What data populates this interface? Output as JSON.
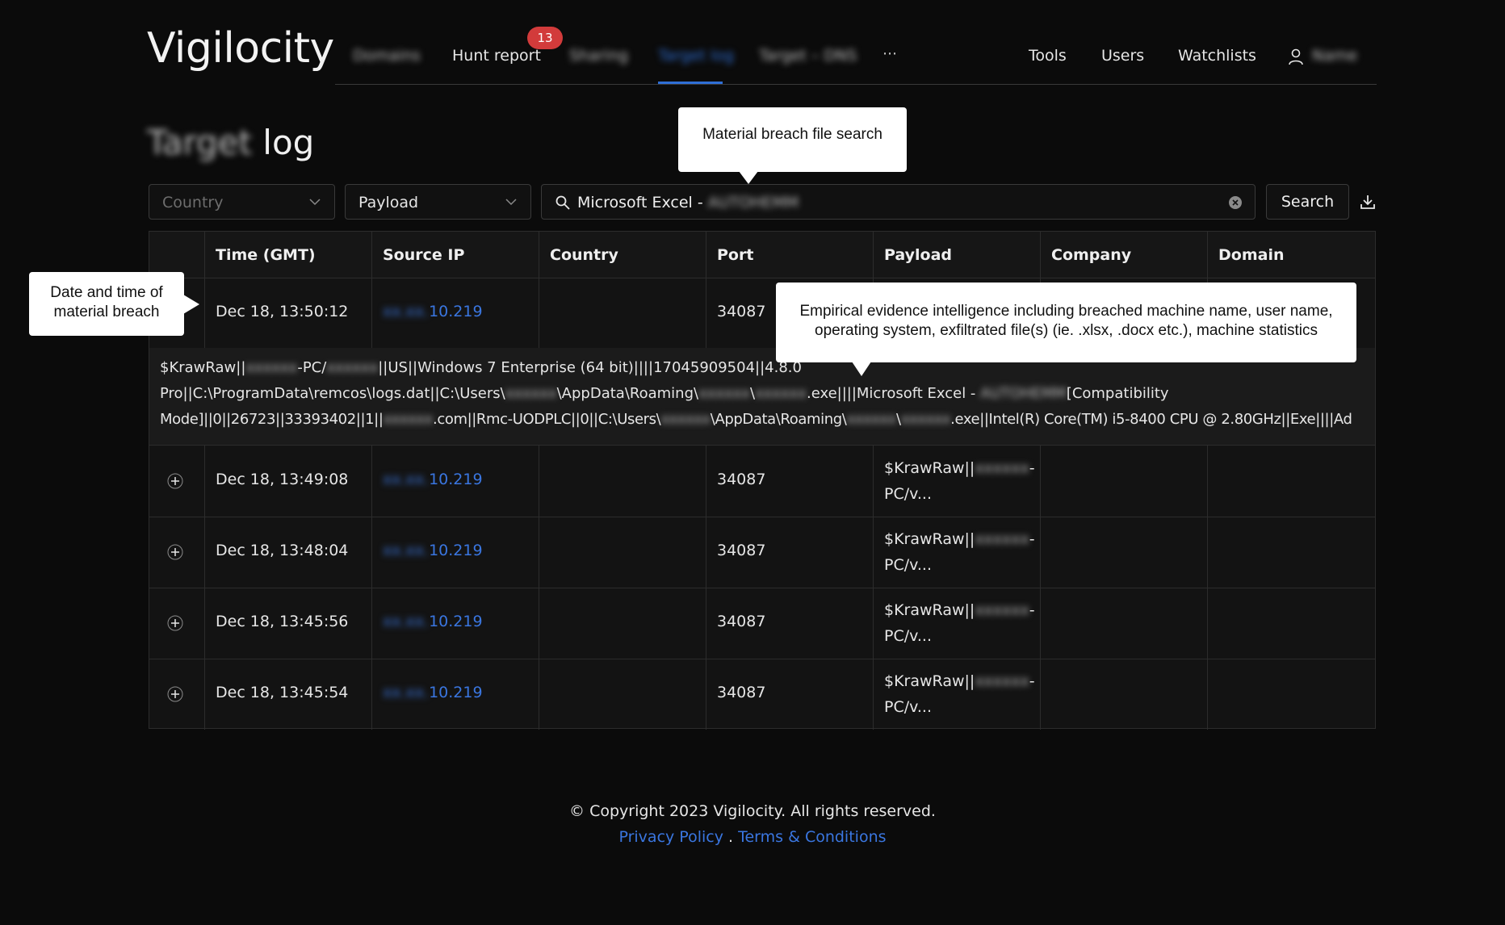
{
  "header": {
    "logo": "Vigilocity",
    "nav": [
      {
        "label": "Domains",
        "blurred": true
      },
      {
        "label": "Hunt report",
        "badge": "13"
      },
      {
        "label": "Sharing",
        "blurred": true
      },
      {
        "label": "Target log",
        "blurred": true,
        "active": true
      },
      {
        "label": "Target – DNS",
        "blurred": true
      }
    ],
    "more": "⋯",
    "right": [
      "Tools",
      "Users",
      "Watchlists"
    ],
    "user_name": "Name"
  },
  "page": {
    "title_prefix": "Target",
    "title_suffix": "log"
  },
  "filters": {
    "country_placeholder": "Country",
    "payload_value": "Payload",
    "search_value": "Microsoft Excel -",
    "search_value_blurred": "AUTOHEMM",
    "search_button": "Search"
  },
  "table": {
    "columns": [
      "Time (GMT)",
      "Source IP",
      "Country",
      "Port",
      "Payload",
      "Company",
      "Domain"
    ],
    "rows": [
      {
        "time": "Dec 18, 13:50:12",
        "ip_prefix": "xx.xx.",
        "ip_suffix": "10.219",
        "country": "",
        "port": "34087",
        "payload_1": "",
        "payload_2": "",
        "company": "",
        "domain": ""
      },
      {
        "time": "Dec 18, 13:49:08",
        "ip_prefix": "xx.xx.",
        "ip_suffix": "10.219",
        "country": "",
        "port": "34087",
        "payload_1": "$KrawRaw||",
        "payload_2": "PC/v...",
        "company": "",
        "domain": ""
      },
      {
        "time": "Dec 18, 13:48:04",
        "ip_prefix": "xx.xx.",
        "ip_suffix": "10.219",
        "country": "",
        "port": "34087",
        "payload_1": "$KrawRaw||",
        "payload_2": "PC/v...",
        "company": "",
        "domain": ""
      },
      {
        "time": "Dec 18, 13:45:56",
        "ip_prefix": "xx.xx.",
        "ip_suffix": "10.219",
        "country": "",
        "port": "34087",
        "payload_1": "$KrawRaw||",
        "payload_2": "PC/v...",
        "company": "",
        "domain": ""
      },
      {
        "time": "Dec 18, 13:45:54",
        "ip_prefix": "xx.xx.",
        "ip_suffix": "10.219",
        "country": "",
        "port": "34087",
        "payload_1": "$KrawRaw||",
        "payload_2": "PC/v...",
        "company": "",
        "domain": ""
      }
    ],
    "expanded_detail": {
      "l1_a": "$KrawRaw||",
      "l1_b": "-PC/",
      "l1_c": "||US||Windows 7 Enterprise (64 bit)||||17045909504||4.8.0",
      "l2_a": "Pro||C:\\ProgramData\\remcos\\logs.dat||C:\\Users\\",
      "l2_b": "\\AppData\\Roaming\\",
      "l2_c": "\\",
      "l2_d": ".exe||||Microsoft Excel -",
      "l2_e": "[Compatibility",
      "l3_a": "Mode]||0||26723||33393402||1||",
      "l3_b": ".com||Rmc-UODPLC||0||C:\\Users\\",
      "l3_c": "\\AppData\\Roaming\\",
      "l3_d": "\\",
      "l3_e": ".exe||Intel(R) Core(TM) i5-8400 CPU @ 2.80GHz||Exe||||Ad",
      "mask": "xxxxxx"
    }
  },
  "callouts": {
    "search": "Material breach file search",
    "time_l1": "Date and time of",
    "time_l2": "material breach",
    "payload_l1": "Empirical evidence intelligence including breached machine name, user name,",
    "payload_l2": "operating system, exfiltrated file(s) (ie. .xlsx, .docx etc.), machine statistics"
  },
  "footer": {
    "copyright": "© Copyright 2023 Vigilocity. All rights reserved.",
    "privacy": "Privacy Policy",
    "sep": ".",
    "terms": "Terms & Conditions"
  },
  "colors": {
    "background": "#0b0b0b",
    "accent": "#2f6fd6",
    "badge": "#d23b3b",
    "link": "#3a76e0"
  },
  "icons": [
    "user-icon",
    "search-icon",
    "clear-icon",
    "chevron-down-icon",
    "download-icon",
    "plus-icon"
  ]
}
